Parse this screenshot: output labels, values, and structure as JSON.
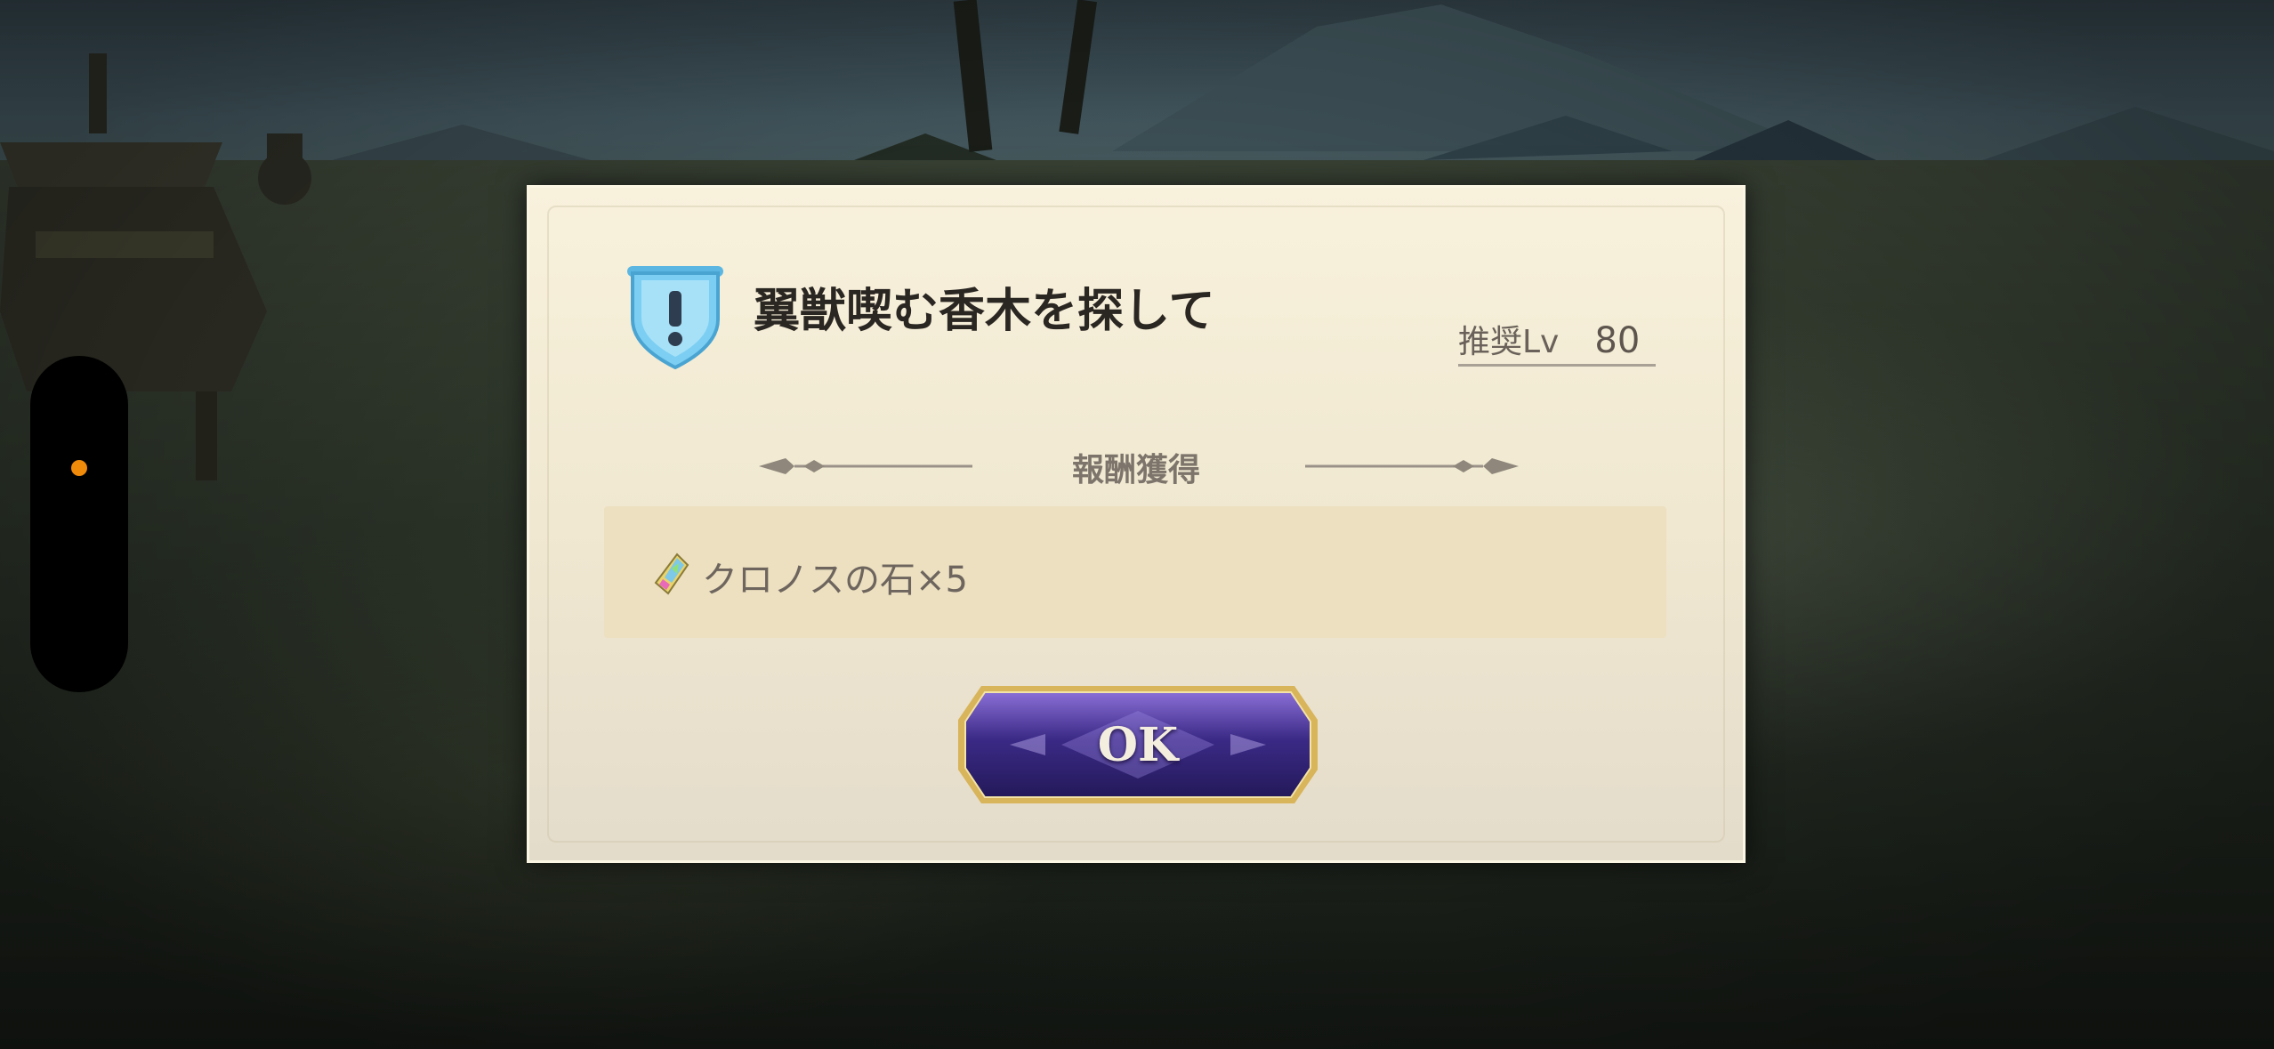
{
  "quest": {
    "title": "翼獣喫む香木を探して",
    "recommended_level_label": "推奨Lv",
    "recommended_level_value": "80"
  },
  "reward": {
    "heading": "報酬獲得",
    "item_text": "クロノスの石×5",
    "item_icon": "chronos-stone-icon"
  },
  "actions": {
    "ok_label": "OK"
  },
  "colors": {
    "dialog_bg": "#f0e8d0",
    "reward_box_bg": "#ece0c0",
    "ok_button_purple": "#3b2a86",
    "ok_button_gold": "#d8b45a",
    "quest_icon_blue": "#6ec9ef",
    "side_indicator_dot": "#f08a0a"
  }
}
